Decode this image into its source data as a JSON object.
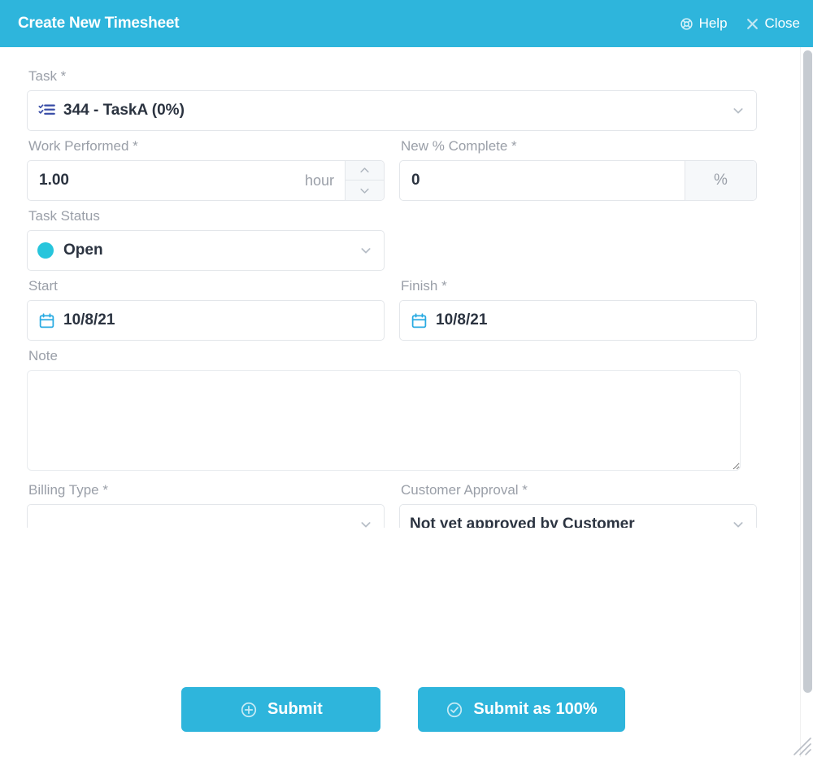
{
  "header": {
    "title": "Create New Timesheet",
    "help_label": "Help",
    "help_icon": "lifebuoy-icon",
    "close_label": "Close",
    "close_icon": "x-icon",
    "background_color": "#2EB5DC"
  },
  "form": {
    "task": {
      "label": "Task *",
      "value": "344 - TaskA (0%)",
      "icon": "task-checklist-icon",
      "icon_color": "#3B4FA8",
      "chevron": "chevron-down-icon"
    },
    "work_performed": {
      "label": "Work Performed *",
      "value": "1.00",
      "unit": "hour",
      "spinner_up": "chevron-up-icon",
      "spinner_down": "chevron-down-icon"
    },
    "new_percent_complete": {
      "label": "New % Complete *",
      "value": "0",
      "addon": "%"
    },
    "task_status": {
      "label": "Task Status",
      "value": "Open",
      "dot_color": "#27C5DC",
      "chevron": "chevron-down-icon"
    },
    "start": {
      "label": "Start",
      "value": "10/8/21",
      "icon": "calendar-icon",
      "icon_color": "#29ABE2"
    },
    "finish": {
      "label": "Finish *",
      "value": "10/8/21",
      "icon": "calendar-icon",
      "icon_color": "#29ABE2"
    },
    "note": {
      "label": "Note",
      "value": "",
      "placeholder": ""
    },
    "billing_type": {
      "label": "Billing Type *",
      "value": "",
      "chevron": "chevron-down-icon"
    },
    "customer_approval": {
      "label": "Customer Approval *",
      "value": "Not yet approved by Customer",
      "chevron": "chevron-down-icon"
    }
  },
  "footer": {
    "submit_label": "Submit",
    "submit_icon": "plus-circle-icon",
    "submit_100_label": "Submit as 100%",
    "submit_100_icon": "check-circle-icon",
    "button_color": "#2EB5DC"
  },
  "chrome": {
    "scrollbar": "vertical-scrollbar",
    "resize_grip": "resize-grip-icon"
  }
}
